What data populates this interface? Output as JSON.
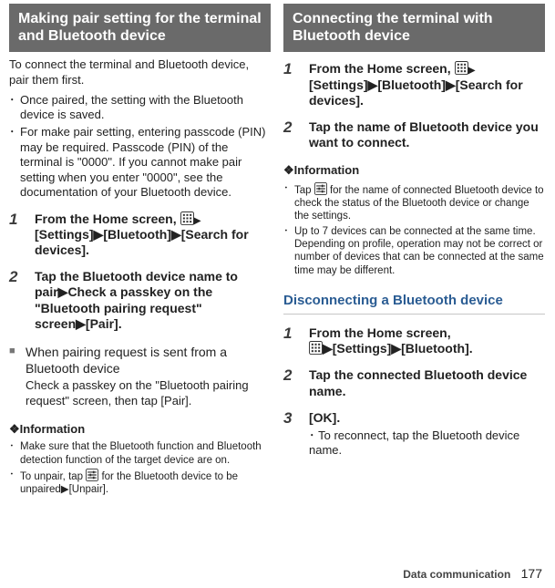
{
  "left": {
    "header": "Making pair setting for the terminal and Bluetooth device",
    "intro": "To connect the terminal and Bluetooth device, pair them first.",
    "bullets": [
      "Once paired, the setting with the Bluetooth device is saved.",
      "For make pair setting, entering passcode (PIN) may be required. Passcode (PIN) of the terminal is \"0000\". If you cannot make pair setting when you enter \"0000\", see the documentation of your Bluetooth device."
    ],
    "step1_pre": "From the Home screen, ",
    "step1_post": "[Settings]▶[Bluetooth]▶[Search for devices].",
    "step2": "Tap the Bluetooth device name to pair▶Check a passkey on the \"Bluetooth pairing request\" screen▶[Pair].",
    "sub_title": "When pairing request is sent from a Bluetooth device",
    "sub_body": "Check a passkey on the \"Bluetooth pairing request\" screen, then tap [Pair].",
    "info_label": "❖Information",
    "info": [
      "Make sure that the Bluetooth function and Bluetooth detection function of the target device are on.",
      {
        "pre": "To unpair, tap ",
        "post": " for the Bluetooth device to be unpaired▶[Unpair]."
      }
    ]
  },
  "right": {
    "header": "Connecting the terminal with Bluetooth device",
    "step1_pre": "From the Home screen, ",
    "step1_post": "[Settings]▶[Bluetooth]▶[Search for devices].",
    "step2": "Tap the name of Bluetooth device you want to connect.",
    "info_label": "❖Information",
    "info": [
      {
        "pre": "Tap ",
        "post": " for the name of connected Bluetooth device to check the status of the Bluetooth device or change the settings."
      },
      "Up to 7 devices can be connected at the same time. Depending on profile, operation may not be correct or number of devices that can be connected at the same time may be different."
    ],
    "disc_header": "Disconnecting a Bluetooth device",
    "disc_step1_pre": "From the Home screen, ",
    "disc_step1_post": "▶[Settings]▶[Bluetooth].",
    "disc_step2": "Tap the connected Bluetooth device name.",
    "disc_step3": "[OK].",
    "disc_step3_sub": "To reconnect, tap the Bluetooth device name."
  },
  "footer": {
    "section": "Data communication",
    "page": "177"
  },
  "glyphs": {
    "tri": "▶",
    "dot": "･",
    "sq": "■",
    "diamond": "❖"
  }
}
